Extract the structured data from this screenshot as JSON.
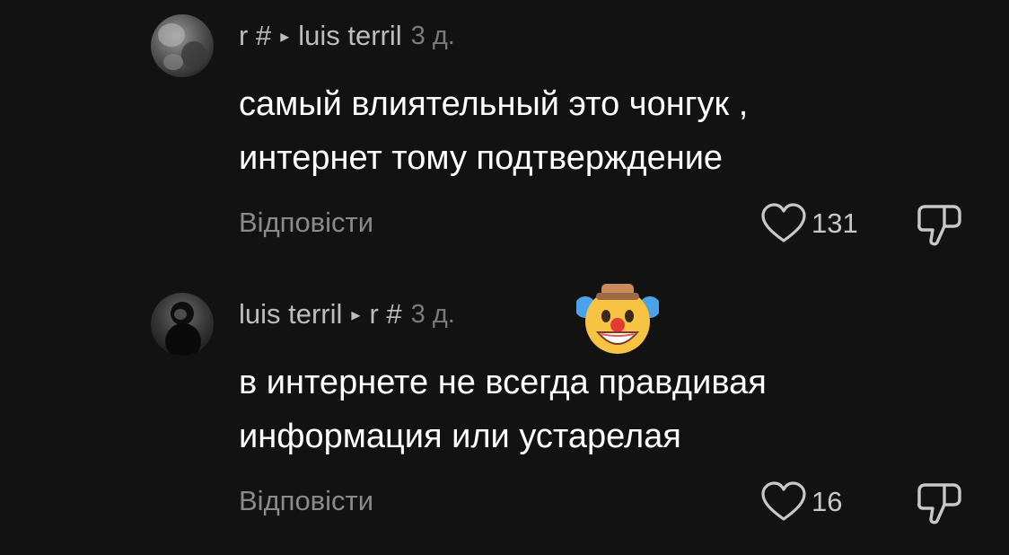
{
  "comments": [
    {
      "author": "r #",
      "reply_to": "luis terril",
      "time": "3 д.",
      "text_line1": "самый влиятельный это чонгук ,",
      "text_line2": "интернет тому подтверждение",
      "reply_label": "Відповісти",
      "likes": "131"
    },
    {
      "author": "luis terril",
      "reply_to": "r #",
      "time": "3 д.",
      "text_line1": "в интернете не всегда правдивая",
      "text_line2": "информация или устарелая",
      "reply_label": "Відповісти",
      "likes": "16",
      "emoji": "clown-face"
    }
  ],
  "icons": {
    "arrow": "▸",
    "like": "heart-outline-icon",
    "dislike": "thumbs-down-outline-icon"
  },
  "colors": {
    "background": "#121212",
    "text": "#ffffff",
    "secondary": "#8a8a8a"
  }
}
